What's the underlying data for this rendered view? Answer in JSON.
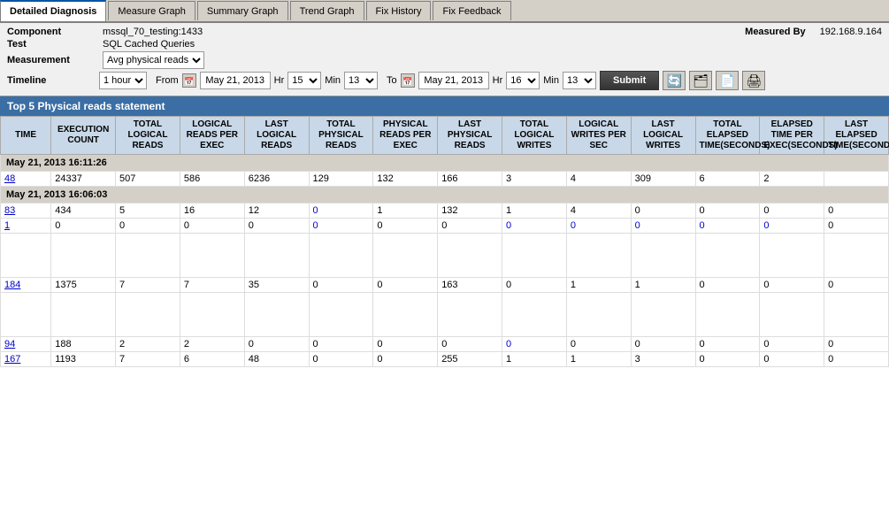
{
  "tabs": [
    {
      "id": "detailed-diagnosis",
      "label": "Detailed Diagnosis",
      "active": true
    },
    {
      "id": "measure-graph",
      "label": "Measure Graph",
      "active": false
    },
    {
      "id": "summary-graph",
      "label": "Summary Graph",
      "active": false
    },
    {
      "id": "trend-graph",
      "label": "Trend Graph",
      "active": false
    },
    {
      "id": "fix-history",
      "label": "Fix History",
      "active": false
    },
    {
      "id": "fix-feedback",
      "label": "Fix Feedback",
      "active": false
    }
  ],
  "info": {
    "component_label": "Component",
    "component_value": "mssql_70_testing:1433",
    "test_label": "Test",
    "test_value": "SQL Cached Queries",
    "measurement_label": "Measurement",
    "measurement_value": "Avg physical reads",
    "timeline_label": "Timeline",
    "measured_by_label": "Measured By",
    "measured_by_value": "192.168.9.164",
    "duration": "1 hour",
    "from_date": "May 21, 2013",
    "from_hr": "15",
    "from_min": "13",
    "to_date": "May 21, 2013",
    "to_hr": "16",
    "to_min": "13",
    "submit_label": "Submit"
  },
  "section_title": "Top 5 Physical reads statement",
  "columns": [
    "TIME",
    "EXECUTION COUNT",
    "TOTAL LOGICAL READS",
    "LOGICAL READS PER EXEC",
    "LAST LOGICAL READS",
    "TOTAL PHYSICAL READS",
    "PHYSICAL READS PER EXEC",
    "LAST PHYSICAL READS",
    "TOTAL LOGICAL WRITES",
    "LOGICAL WRITES PER SEC",
    "LAST LOGICAL WRITES",
    "TOTAL ELAPSED TIME(SECONDS)",
    "ELAPSED TIME PER EXEC(SECONDS)",
    "LAST ELAPSED TIME(SECOND"
  ],
  "groups": [
    {
      "header": "May 21, 2013 16:11:26",
      "rows": [
        {
          "time_link": "48",
          "exec_count": "24337",
          "total_lr": "507",
          "lr_per_exec": "586",
          "last_lr": "6236",
          "total_pr": "129",
          "pr_per_exec": "132",
          "last_pr": "166",
          "total_lw": "3",
          "lw_per_sec": "4",
          "last_lw": "309",
          "total_elapsed": "6",
          "elapsed_per_exec": "2",
          "last_elapsed": "",
          "is_link": true
        }
      ]
    },
    {
      "header": "May 21, 2013 16:06:03",
      "rows": [
        {
          "time_link": "83",
          "exec_count": "434",
          "total_lr": "5",
          "lr_per_exec": "16",
          "last_lr": "12",
          "total_pr": "0",
          "pr_per_exec": "1",
          "last_pr": "132",
          "total_lw": "1",
          "lw_per_sec": "4",
          "last_lw": "0",
          "total_elapsed": "0",
          "elapsed_per_exec": "0",
          "last_elapsed": "0",
          "is_link": true,
          "pr_blue": true
        },
        {
          "time_link": "1",
          "exec_count": "0",
          "total_lr": "0",
          "lr_per_exec": "0",
          "last_lr": "0",
          "total_pr": "0",
          "pr_per_exec": "0",
          "last_pr": "0",
          "total_lw": "0",
          "lw_per_sec": "0",
          "last_lw": "0",
          "total_elapsed": "0",
          "elapsed_per_exec": "0",
          "last_elapsed": "0",
          "is_link": true,
          "all_blue": true
        },
        {
          "time_link": "184",
          "exec_count": "1375",
          "total_lr": "7",
          "lr_per_exec": "7",
          "last_lr": "35",
          "total_pr": "0",
          "pr_per_exec": "0",
          "last_pr": "163",
          "total_lw": "0",
          "lw_per_sec": "1",
          "last_lw": "1",
          "total_elapsed": "0",
          "elapsed_per_exec": "0",
          "last_elapsed": "0",
          "is_link": true
        },
        {
          "time_link": "94",
          "exec_count": "188",
          "total_lr": "2",
          "lr_per_exec": "2",
          "last_lr": "0",
          "total_pr": "0",
          "pr_per_exec": "0",
          "last_pr": "0",
          "total_lw": "0",
          "lw_per_sec": "0",
          "last_lw": "0",
          "total_elapsed": "0",
          "elapsed_per_exec": "0",
          "last_elapsed": "0",
          "is_link": true,
          "lw_blue": true
        },
        {
          "time_link": "167",
          "exec_count": "1193",
          "total_lr": "7",
          "lr_per_exec": "6",
          "last_lr": "48",
          "total_pr": "0",
          "pr_per_exec": "0",
          "last_pr": "255",
          "total_lw": "1",
          "lw_per_sec": "1",
          "last_lw": "3",
          "total_elapsed": "0",
          "elapsed_per_exec": "0",
          "last_elapsed": "0",
          "is_link": true
        }
      ]
    }
  ]
}
